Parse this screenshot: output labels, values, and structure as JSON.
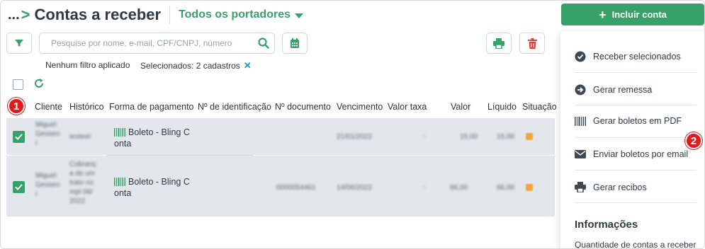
{
  "header": {
    "back_dots": "...",
    "back_chevron": ">",
    "title": "Contas a receber",
    "portador": "Todos os portadores"
  },
  "actions": {
    "incluir_label": "Incluir conta"
  },
  "search": {
    "placeholder": "Pesquise por nome, e-mail, CPF/CNPJ, número",
    "value": ""
  },
  "status": {
    "filter": "Nenhum filtro aplicado",
    "selected": "Selecionados: 2 cadastros",
    "clear": "✕"
  },
  "table": {
    "columns": [
      "Cliente",
      "Histórico",
      "Forma de pagamento",
      "Nº de identificação",
      "Nº documento",
      "Vencimento",
      "Valor taxa",
      "Valor",
      "Líquido",
      "Situação"
    ],
    "rows": [
      {
        "cliente": [
          "Miguel",
          "Gessen",
          "i"
        ],
        "historico": [
          "testeel"
        ],
        "forma_line1": "Boleto - Bling C",
        "forma_line2": "onta",
        "documento": "",
        "vencimento": "21/01/2022",
        "taxa": "-",
        "valor": "15,00",
        "liquido": "15,00",
        "checked": true
      },
      {
        "cliente": [
          "Miguel",
          "Gessen",
          "i"
        ],
        "historico": [
          "Cobranç",
          "a de um",
          "trato no",
          "mpl 06/",
          "2022"
        ],
        "forma_line1": "Boleto - Bling C",
        "forma_line2": "onta",
        "documento": "0000054461",
        "vencimento": "14/06/2022",
        "taxa": "-",
        "valor": "66,00",
        "liquido": "66,00",
        "checked": true
      }
    ]
  },
  "badges": {
    "one": "1",
    "two": "2"
  },
  "side_menu": {
    "items": [
      "Receber selecionados",
      "Gerar remessa",
      "Gerar boletos em PDF",
      "Enviar boletos por email",
      "Gerar recibos"
    ],
    "info_title": "Informações",
    "info_text": "Quantidade de contas a receber"
  },
  "colors": {
    "accent": "#38a169",
    "danger": "#e53e3e",
    "badge": "#e01b1b",
    "row_selected": "#e3e7ec",
    "status": "#f0a63a"
  }
}
